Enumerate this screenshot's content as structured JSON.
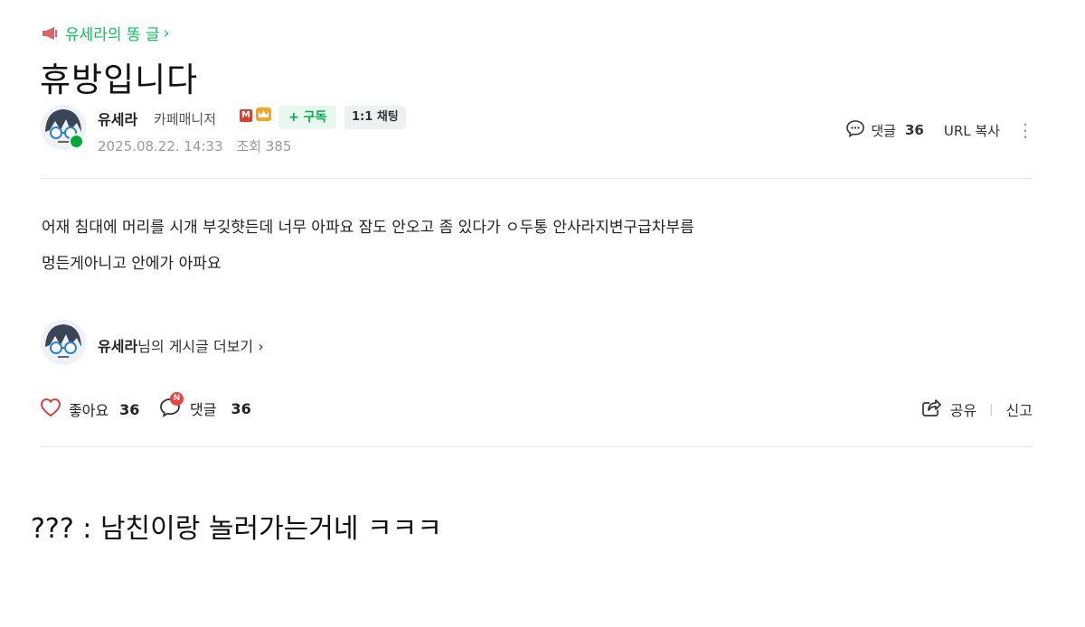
{
  "board": {
    "link_text": "유세라의 똥 글",
    "chevron": "›",
    "icon": "megaphone-icon"
  },
  "post": {
    "title": "휴방입니다",
    "author": {
      "name": "유세라",
      "role": "카페매니저",
      "badge_m": "M",
      "subscribe_label": "+ 구독",
      "chat_label": "1:1 채팅"
    },
    "date": "2025.08.22. 14:33",
    "views_label": "조회 385",
    "top_actions": {
      "comment_label": "댓글",
      "comment_count": "36",
      "url_copy_label": "URL 복사",
      "more_icon": "⋮"
    },
    "body_lines": [
      "어재 침대에 머리를 시개 부깆햣든데 너무 아파요 잠도 안오고 좀 있다가 ㅇ두통 안사라지변구급차부름",
      "멍든게아니고 안에가 아파요"
    ]
  },
  "author_more": {
    "name": "유세라",
    "suffix": "님의 게시글 더보기 ›"
  },
  "footer": {
    "like_label": "좋아요",
    "like_count": "36",
    "comment_label": "댓글",
    "comment_count": "36",
    "new_badge": "N",
    "share_label": "공유",
    "separator": "|",
    "report_label": "신고"
  },
  "caption": "??? : 남친이랑 놀러가는거네 ㅋㅋㅋ",
  "colors": {
    "accent_green": "#03c75a",
    "heart_red": "#e03030",
    "badge_red": "#f04040"
  }
}
